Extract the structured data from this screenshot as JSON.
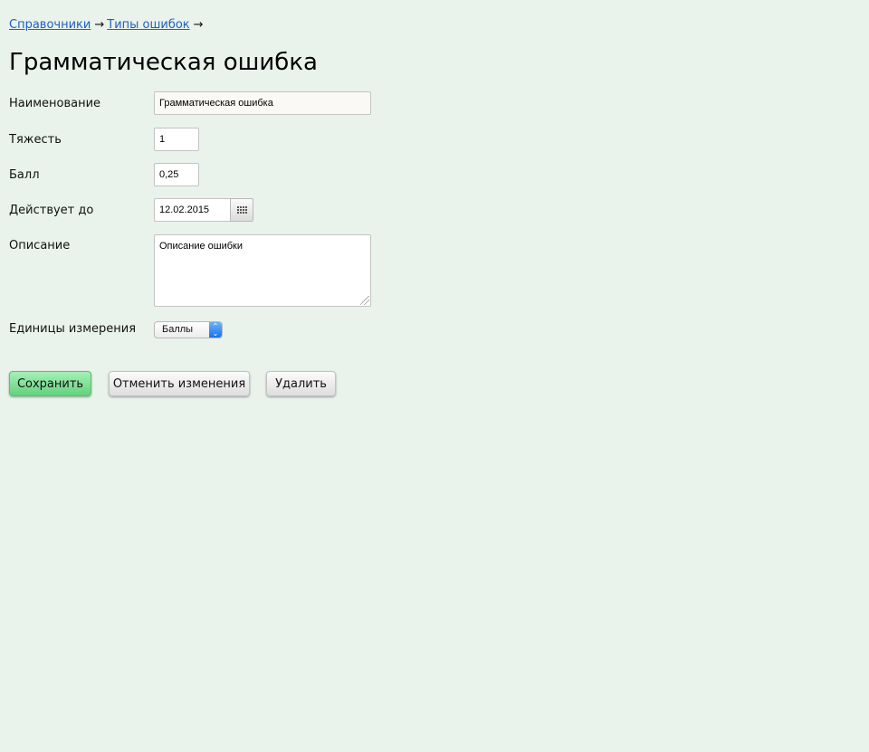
{
  "breadcrumb": {
    "items": [
      "Справочники",
      "Типы ошибок"
    ],
    "separator": "→"
  },
  "page_title": "Грамматическая ошибка",
  "form": {
    "name": {
      "label": "Наименование",
      "value": "Грамматическая ошибка"
    },
    "severity": {
      "label": "Тяжесть",
      "value": "1"
    },
    "score": {
      "label": "Балл",
      "value": "0,25"
    },
    "valid_until": {
      "label": "Действует до",
      "value": "12.02.2015",
      "button_icon": "calendar-grid-icon"
    },
    "description": {
      "label": "Описание",
      "value": "Описание ошибки"
    },
    "units": {
      "label": "Единицы измерения",
      "selected": "Баллы"
    }
  },
  "actions": {
    "save": "Сохранить",
    "cancel": "Отменить изменения",
    "delete": "Удалить"
  },
  "colors": {
    "background": "#e9f3ec",
    "link": "#1f5fbf",
    "save_button": "#62d27e",
    "select_arrow": "#1a73e8"
  }
}
